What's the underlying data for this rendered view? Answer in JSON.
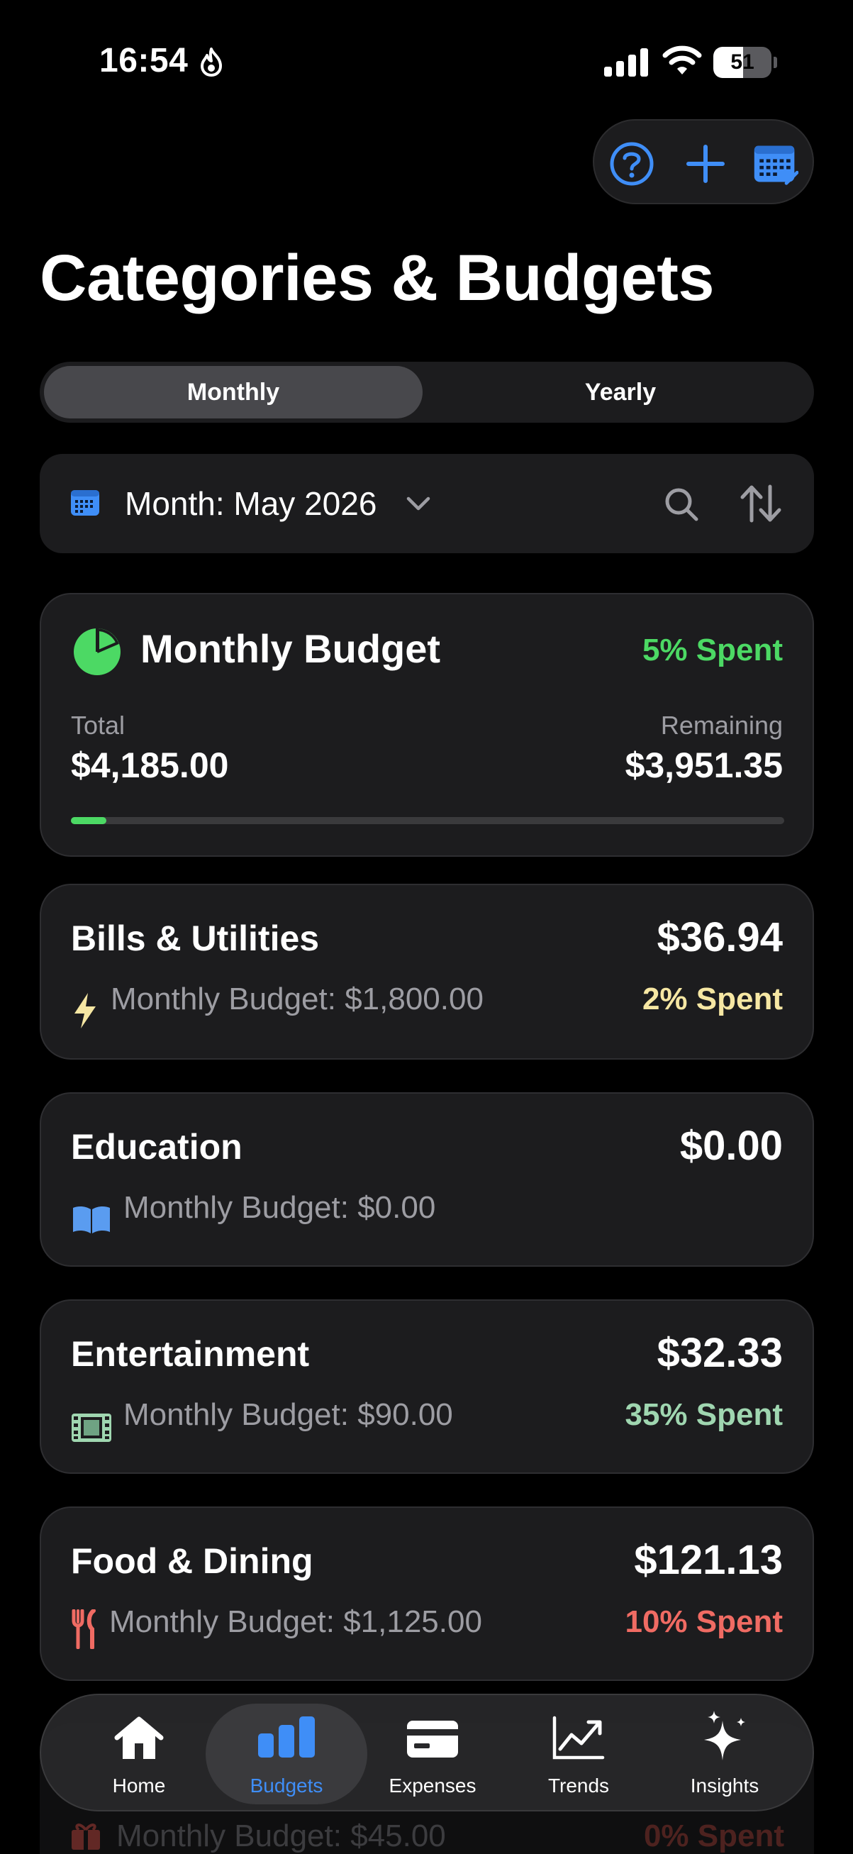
{
  "status_bar": {
    "time": "16:54",
    "battery": "51",
    "battery_level": 0.51
  },
  "colors": {
    "accent": "#3f8ef7",
    "green": "#4cd964",
    "yellow": "#f6e7a3",
    "mint": "#9fd6b0",
    "red": "#f06b63"
  },
  "toolbar": {
    "icons": [
      "help-icon",
      "add-icon",
      "calendar-icon"
    ]
  },
  "header": {
    "title": "Categories & Budgets"
  },
  "period_tabs": [
    {
      "label": "Monthly",
      "selected": true
    },
    {
      "label": "Yearly",
      "selected": false
    }
  ],
  "filter": {
    "label": "Month: May 2026",
    "icons": [
      "calendar-icon",
      "chevron-down-icon",
      "search-icon",
      "sort-icon"
    ]
  },
  "summary": {
    "title": "Monthly Budget",
    "spent_label": "5% Spent",
    "spent_fraction": 0.05,
    "total_label": "Total",
    "total_value": "$4,185.00",
    "remaining_label": "Remaining",
    "remaining_value": "$3,951.35"
  },
  "categories": [
    {
      "name": "Bills & Utilities",
      "amount": "$36.94",
      "budget": "Monthly Budget: $1,800.00",
      "pct": "2% Spent",
      "icon": "bolt-icon"
    },
    {
      "name": "Education",
      "amount": "$0.00",
      "budget": "Monthly Budget: $0.00",
      "pct": "",
      "icon": "book-icon"
    },
    {
      "name": "Entertainment",
      "amount": "$32.33",
      "budget": "Monthly Budget: $90.00",
      "pct": "35% Spent",
      "icon": "film-icon"
    },
    {
      "name": "Food & Dining",
      "amount": "$121.13",
      "budget": "Monthly Budget: $1,125.00",
      "pct": "10% Spent",
      "icon": "fork-knife-icon"
    }
  ],
  "partial_card": {
    "budget": "Monthly Budget: $45.00",
    "pct": "0% Spent",
    "icon": "gift-icon"
  },
  "tabbar": [
    {
      "label": "Home",
      "icon": "house-icon",
      "selected": false
    },
    {
      "label": "Budgets",
      "icon": "bar-chart-icon",
      "selected": true
    },
    {
      "label": "Expenses",
      "icon": "card-icon",
      "selected": false
    },
    {
      "label": "Trends",
      "icon": "trend-icon",
      "selected": false
    },
    {
      "label": "Insights",
      "icon": "sparkles-icon",
      "selected": false
    }
  ]
}
